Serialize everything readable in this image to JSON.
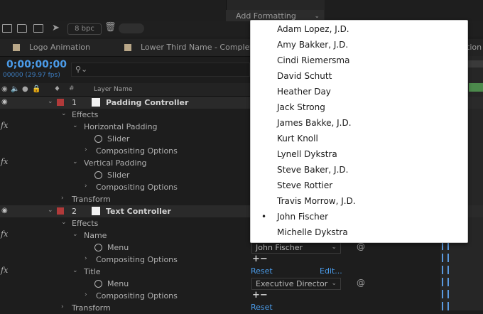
{
  "top": {
    "add_formatting": "Add Formatting",
    "bpc": "8 bpc"
  },
  "tabs": [
    {
      "label": "Logo Animation"
    },
    {
      "label": "Lower Third Name - Complete"
    },
    {
      "label": "tion"
    }
  ],
  "time": {
    "timecode": "0;00;00;00",
    "fps": "00000 (29.97 fps)"
  },
  "columns": {
    "hash": "#",
    "layer_name": "Layer Name"
  },
  "layers": [
    {
      "number": "1",
      "name": "Padding Controller",
      "effects_label": "Effects",
      "effect1": "Horizontal Padding",
      "effect1_slider": "Slider",
      "effect1_compositing": "Compositing Options",
      "effect2": "Vertical Padding",
      "effect2_slider": "Slider",
      "effect2_compositing": "Compositing Options",
      "transform": "Transform"
    },
    {
      "number": "2",
      "name": "Text Controller",
      "effects_label": "Effects",
      "effect1": "Name",
      "effect1_menu": "Menu",
      "effect1_compositing": "Compositing Options",
      "effect2": "Title",
      "effect2_menu": "Menu",
      "effect2_compositing": "Compositing Options",
      "transform": "Transform"
    }
  ],
  "controls": {
    "name_menu_value": "John Fischer",
    "title_menu_value": "Executive Director",
    "reset": "Reset",
    "edit": "Edit...",
    "reset2": "Reset",
    "plusminus": "+−"
  },
  "dropdown": {
    "selected_index": 12,
    "options": [
      "Adam Lopez, J.D.",
      "Amy Bakker, J.D.",
      "Cindi Riemersma",
      "David Schutt",
      "Heather Day",
      "Jack Strong",
      "James Bakke, J.D.",
      "Kurt Knoll",
      "Lynell Dykstra",
      "Steve Baker, J.D.",
      "Steve Rottier",
      "Travis Morrow, J.D.",
      "John Fischer",
      "Michelle Dykstra"
    ]
  },
  "icons": {
    "fx": "fx",
    "bullet": "•",
    "chevron": "⌄"
  }
}
